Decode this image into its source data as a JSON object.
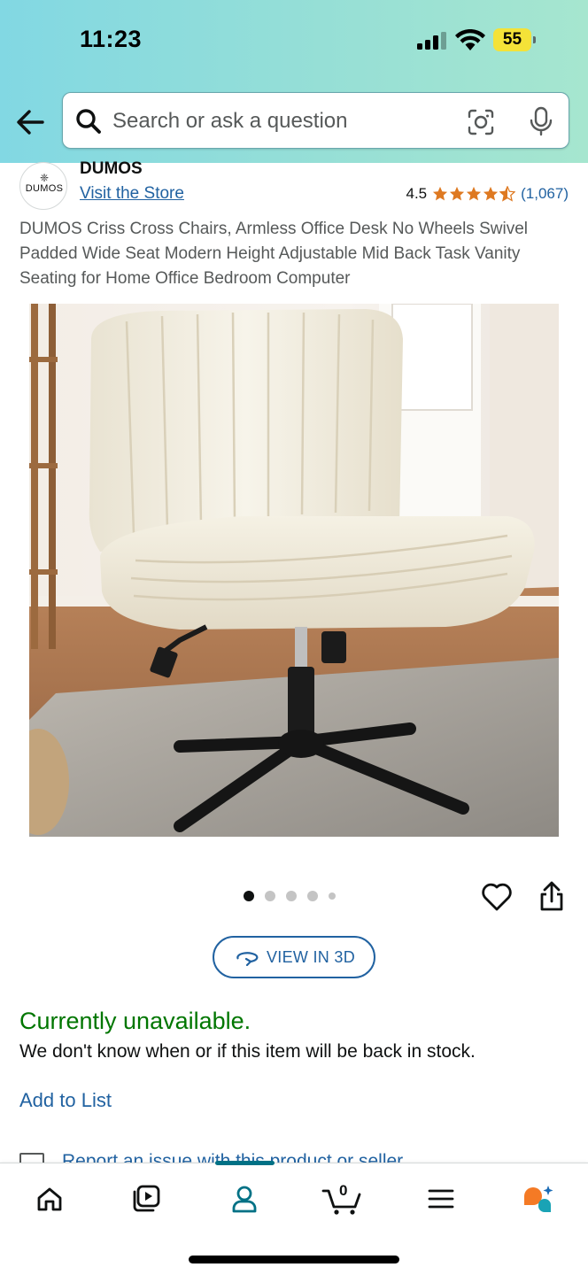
{
  "status_bar": {
    "time": "11:23",
    "battery": "55"
  },
  "search": {
    "placeholder": "Search or ask a question"
  },
  "brand": {
    "name": "DUMOS",
    "logo_text": "DUMOS",
    "store_link": "Visit the Store"
  },
  "rating": {
    "value": "4.5",
    "stars": 4.5,
    "count": "(1,067)"
  },
  "product": {
    "title": "DUMOS Criss Cross Chairs, Armless Office Desk No Wheels Swivel Padded Wide Seat Modern Height Adjustable Mid Back Task Vanity Seating for Home Office Bedroom Computer",
    "image_index": 1,
    "image_count": 5
  },
  "view3d": {
    "label": "VIEW IN 3D"
  },
  "availability": {
    "status": "Currently unavailable.",
    "note": "We don't know when or if this item will be back in stock."
  },
  "actions": {
    "add_to_list": "Add to List",
    "report": "Report an issue with this product or seller"
  },
  "cart": {
    "count": "0"
  },
  "colors": {
    "header_gradient_start": "#82d8e3",
    "header_gradient_end": "#a6e6cf",
    "link": "#2162a1",
    "availability_green": "#007600",
    "star_orange": "#de7921",
    "nav_active": "#007185"
  },
  "icons": [
    "back-arrow-icon",
    "search-icon",
    "camera-lens-icon",
    "microphone-icon",
    "heart-icon",
    "share-icon",
    "rotate-3d-icon",
    "home-icon",
    "video-icon",
    "account-icon",
    "cart-icon",
    "menu-icon",
    "rufus-icon"
  ]
}
